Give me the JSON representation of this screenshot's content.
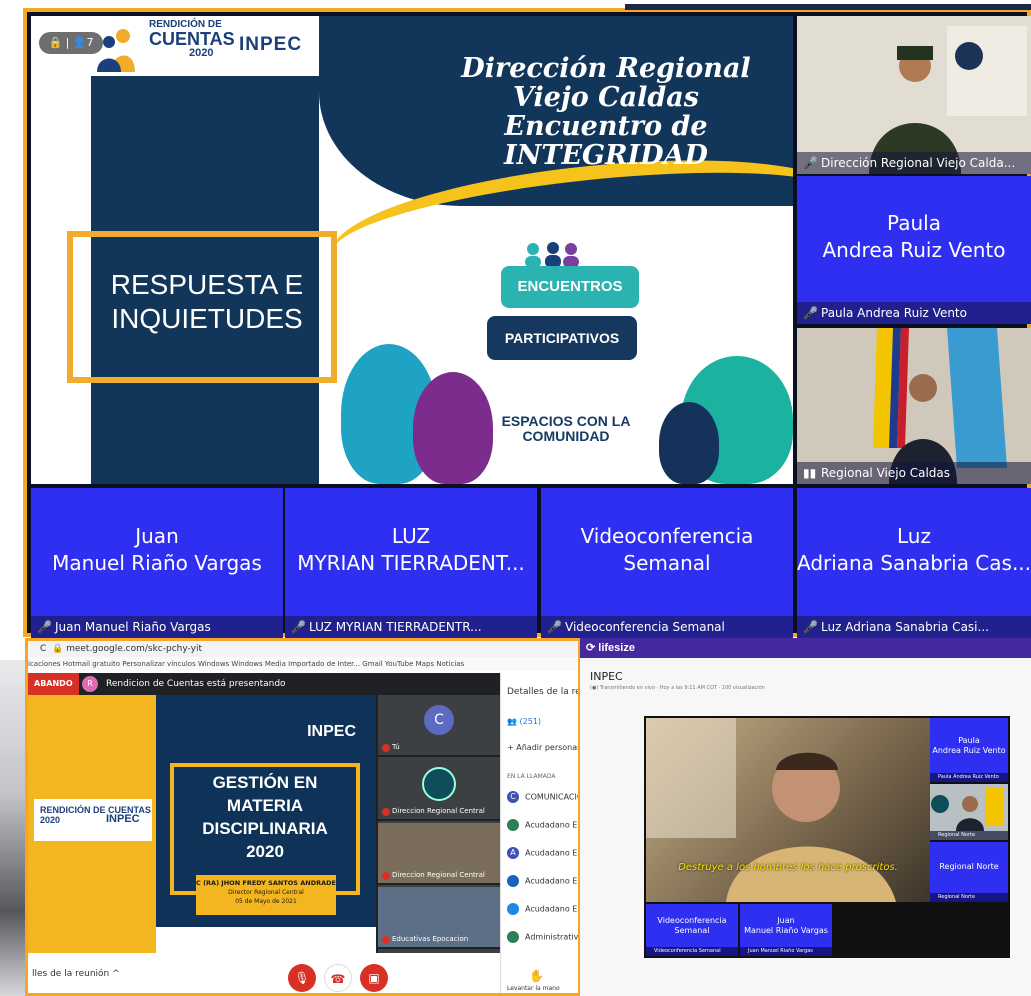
{
  "main": {
    "lock_indicator": "🔒 | 👤7",
    "slide": {
      "logo_line1": "RENDICIÓN DE",
      "logo_line2": "CUENTAS",
      "logo_year": "2020",
      "logo_brand": "INPEC",
      "title_lines": [
        "Dirección Regional",
        "Viejo Caldas",
        "Encuentro de",
        "INTEGRIDAD"
      ],
      "respuesta_lines": [
        "RESPUESTA E",
        "INQUIETUDES"
      ],
      "encuentros": "ENCUENTROS",
      "participativos": "PARTICIPATIVOS",
      "espacios_lines": [
        "ESPACIOS CON LA",
        "COMUNIDAD"
      ]
    },
    "tiles": [
      {
        "caption": "Dirección Regional Viejo Calda..."
      },
      {
        "big_lines": [
          "Paula",
          "Andrea Ruiz Vento"
        ],
        "caption": "Paula Andrea Ruiz Vento"
      },
      {
        "caption": "Regional Viejo Caldas"
      },
      {
        "big_lines": [
          "Juan",
          "Manuel Riaño Vargas"
        ],
        "caption": "Juan Manuel Riaño Vargas"
      },
      {
        "big_lines": [
          "LUZ",
          "MYRIAN TIERRADENT..."
        ],
        "caption": "LUZ MYRIAN TIERRADENTR..."
      },
      {
        "big_lines": [
          "Videoconferencia",
          "Semanal"
        ],
        "caption": "Videoconferencia Semanal"
      },
      {
        "big_lines": [
          "Luz",
          "Adriana Sanabria Cas..."
        ],
        "caption": "Luz Adriana Sanabria Casi..."
      }
    ]
  },
  "meet": {
    "url": "meet.google.com/skc-pchy-yit",
    "bookmarks": "icaciones   Hotmail gratuito   Personalizar vínculos   Windows   Windows Media   Importado de Inter...   Gmail   YouTube   Maps   Noticias",
    "recording": "ABANDO",
    "presenter_avatar": "R",
    "presenting": "Rendicion de Cuentas está presentando",
    "logo_c": "RENDICIÓN DE CUENTAS",
    "logo_year": "2020",
    "logo_brand": "INPEC",
    "slide_brand": "INPEC",
    "slide_title_lines": [
      "GESTIÓN EN",
      "MATERIA",
      "DISCIPLINARIA",
      "2020"
    ],
    "slide_person": "C (RA) JHON FREDY SANTOS ANDRADE",
    "slide_role": "Director Regional Central",
    "slide_date": "05 de Mayo de 2021",
    "thumbs": [
      {
        "avatar": "C",
        "name": "Tú"
      },
      {
        "name": "Direccion Regional Central"
      },
      {
        "name": "Direccion Regional Central"
      },
      {
        "name": "Educativas Epocacion"
      }
    ],
    "side_title": "Detalles de la reunión",
    "people_count": "(251)",
    "add_people": "Añadir personas",
    "in_call": "EN LA LLAMADA",
    "participants": [
      {
        "avatar": "C",
        "name": "COMUNICACIO",
        "color": "#3f51b5"
      },
      {
        "avatar": "",
        "name": "Acudadano Ep",
        "color": "#2e7d5b"
      },
      {
        "avatar": "A",
        "name": "Acudadano Ep",
        "color": "#3f51b5"
      },
      {
        "avatar": "",
        "name": "Acudadano Ep",
        "color": "#1565c0"
      },
      {
        "avatar": "",
        "name": "Acudadano Ep",
        "color": "#1e88e5"
      },
      {
        "avatar": "",
        "name": "Administrativ",
        "color": "#2e7d5b"
      }
    ],
    "details_link": "lles de la reunión  ^",
    "raise_hand": "Levantar la mano"
  },
  "lifesize": {
    "brand": "lifesize",
    "title": "INPEC",
    "subtitle": "(●) Transmitiendo en vivo · Hoy a las 9:11 AM COT · 100 visualización",
    "subtitle_text": "Destruye a los hombres los hace proscritos.",
    "tiles": [
      {
        "lines": [
          "Paula",
          "Andrea Ruiz Vento"
        ],
        "cap": "Paula Andrea Ruiz Vento"
      },
      {
        "lines": [],
        "cap": "Regional Norte"
      },
      {
        "lines": [
          "Regional Norte"
        ],
        "cap": "Regional Norte"
      },
      {
        "lines": [
          "Videoconferencia",
          "Semanal"
        ],
        "cap": "Videoconferencia Semanal"
      },
      {
        "lines": [
          "Juan",
          "Manuel Riaño Vargas"
        ],
        "cap": "Juan Manuel Riaño Vargas"
      }
    ]
  }
}
